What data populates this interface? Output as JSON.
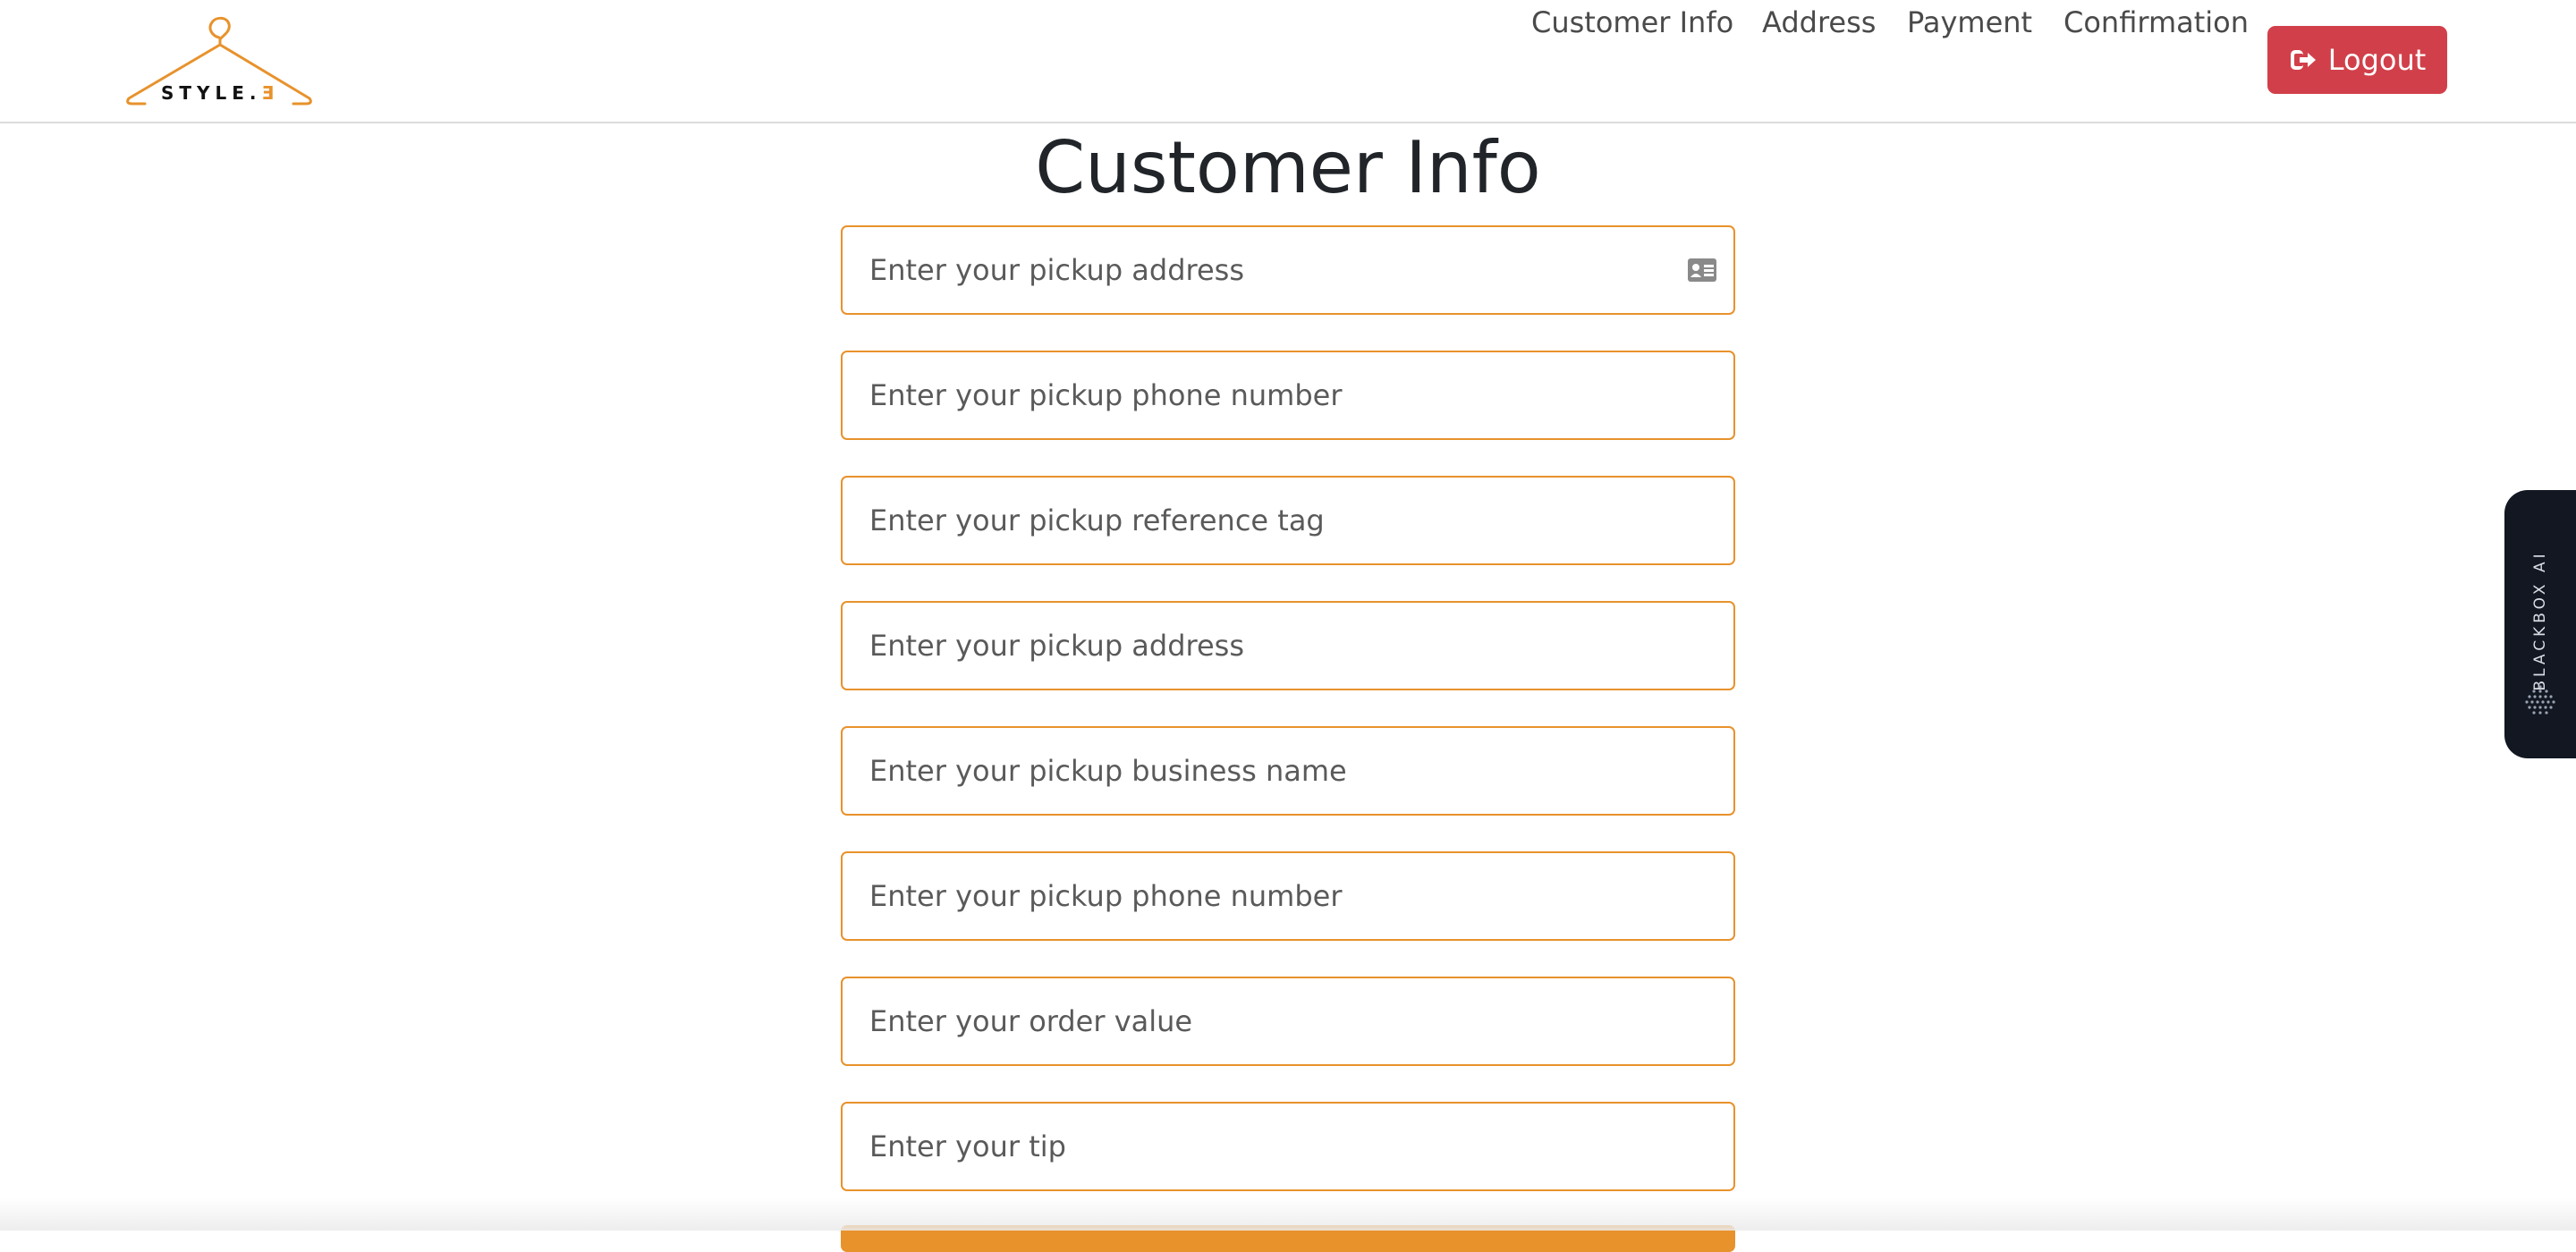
{
  "brand": {
    "logo_text": "STYLE.",
    "logo_accent": "Ǝ",
    "accent_color": "#e8922c"
  },
  "nav": {
    "links": [
      "Customer Info",
      "Address",
      "Payment",
      "Confirmation"
    ],
    "logout_label": "Logout",
    "logout_color": "#d1404a"
  },
  "page": {
    "title": "Customer Info"
  },
  "form": {
    "fields": [
      {
        "placeholder": "Enter your pickup address",
        "icon": "contact-card-icon"
      },
      {
        "placeholder": "Enter your pickup phone number"
      },
      {
        "placeholder": "Enter your pickup reference tag"
      },
      {
        "placeholder": "Enter your pickup address"
      },
      {
        "placeholder": "Enter your pickup business name"
      },
      {
        "placeholder": "Enter your pickup phone number"
      },
      {
        "placeholder": "Enter your order value"
      },
      {
        "placeholder": "Enter your tip"
      }
    ]
  },
  "widget": {
    "label": "BLACKBOX AI",
    "background": "#121722"
  }
}
